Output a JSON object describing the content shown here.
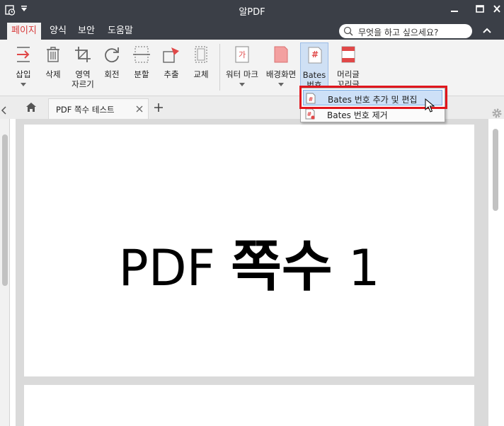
{
  "window": {
    "title": "알PDF"
  },
  "tabs": [
    {
      "label": "페이지",
      "active": true
    },
    {
      "label": "양식",
      "active": false
    },
    {
      "label": "보안",
      "active": false
    },
    {
      "label": "도움말",
      "active": false
    }
  ],
  "search": {
    "text": "무엇을 하고 싶으세요?"
  },
  "ribbon": {
    "buttons": [
      {
        "id": "insert",
        "label": "삽입",
        "icon": "insert-page-icon"
      },
      {
        "id": "delete",
        "label": "삭제",
        "icon": "trash-icon"
      },
      {
        "id": "crop",
        "label": "영역\n자르기",
        "icon": "crop-icon"
      },
      {
        "id": "rotate",
        "label": "회전",
        "icon": "rotate-icon"
      },
      {
        "id": "split",
        "label": "분할",
        "icon": "split-icon"
      },
      {
        "id": "extract",
        "label": "추출",
        "icon": "extract-icon"
      },
      {
        "id": "replace",
        "label": "교체",
        "icon": "replace-icon"
      },
      {
        "id": "watermark",
        "label": "워터 마크",
        "icon": "watermark-icon"
      },
      {
        "id": "background",
        "label": "배경화면",
        "icon": "background-icon"
      },
      {
        "id": "bates",
        "label": "Bates\n번호",
        "icon": "bates-number-icon",
        "pressed": true
      },
      {
        "id": "header",
        "label": "머리글\n꼬리글",
        "icon": "header-footer-icon"
      }
    ]
  },
  "document": {
    "tab_name": "PDF 쪽수 테스트",
    "page_text_prefix": "PDF",
    "page_text_main": "쪽수",
    "page_text_number": "1"
  },
  "dropdown": {
    "items": [
      {
        "label": "Bates 번호 추가 및 편집",
        "highlighted": true
      },
      {
        "label": "Bates 번호 제거",
        "highlighted": false
      }
    ]
  },
  "colors": {
    "titlebar": "#3b3f47",
    "active_tab_text": "#d83b3b",
    "highlight_box": "#e2161d",
    "menu_highlight": "#cde0f7"
  }
}
